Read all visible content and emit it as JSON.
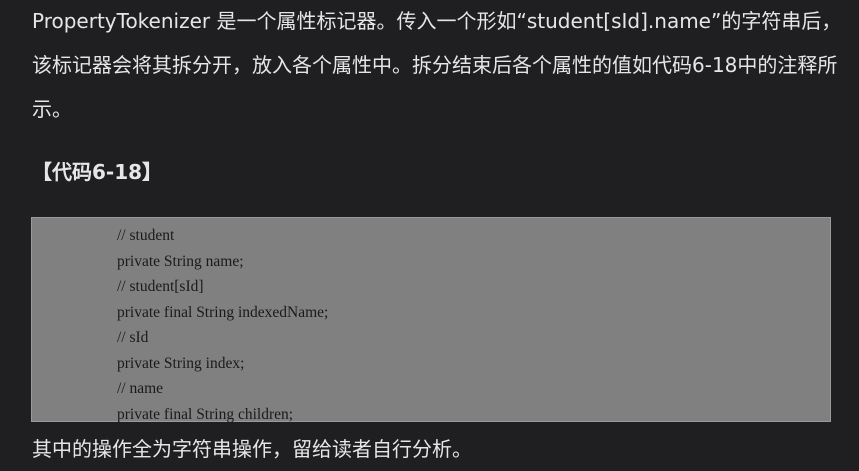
{
  "intro_text": "PropertyTokenizer 是一个属性标记器。传入一个形如“student[sId].name”的字符串后，该标记器会将其拆分开，放入各个属性中。拆分结束后各个属性的值如代码6-18中的注释所示。",
  "code_title": "【代码6-18】",
  "code_lines": [
    "// student",
    "private String name;",
    "// student[sId]",
    "private final String indexedName;",
    "// sId",
    "private String index;",
    "// name",
    "private final String children;"
  ],
  "outro_text": "其中的操作全为字符串操作，留给读者自行分析。"
}
